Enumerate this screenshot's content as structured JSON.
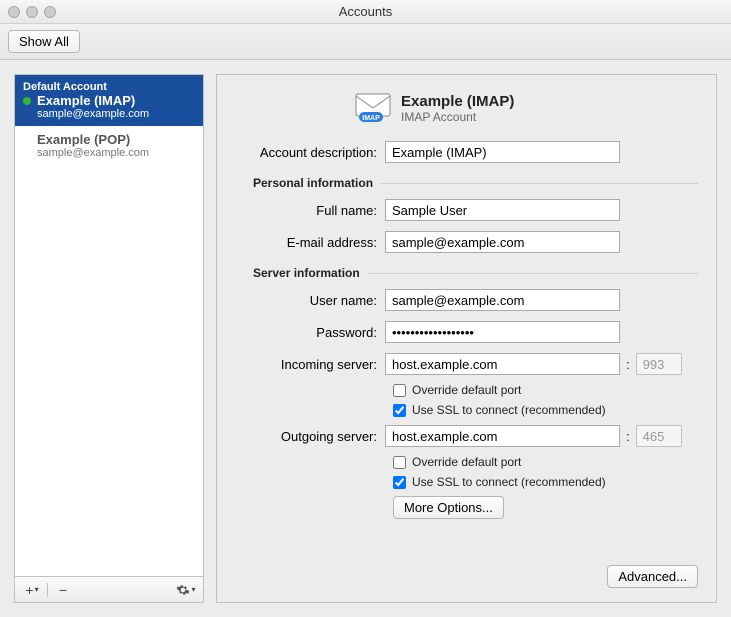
{
  "window": {
    "title": "Accounts"
  },
  "toolbar": {
    "show_all": "Show All"
  },
  "sidebar": {
    "default_label": "Default Account",
    "items": [
      {
        "name": "Example (IMAP)",
        "email": "sample@example.com",
        "selected": true,
        "status": "online"
      },
      {
        "name": "Example (POP)",
        "email": "sample@example.com",
        "selected": false
      }
    ]
  },
  "panel": {
    "title": "Example (IMAP)",
    "subtitle": "IMAP Account",
    "labels": {
      "account_description": "Account description:",
      "personal_info": "Personal information",
      "full_name": "Full name:",
      "email": "E-mail address:",
      "server_info": "Server information",
      "user_name": "User name:",
      "password": "Password:",
      "incoming": "Incoming server:",
      "outgoing": "Outgoing server:",
      "override_port": "Override default port",
      "use_ssl": "Use SSL to connect (recommended)",
      "more_options": "More Options...",
      "advanced": "Advanced...",
      "port_sep": ":"
    },
    "values": {
      "account_description": "Example (IMAP)",
      "full_name": "Sample User",
      "email": "sample@example.com",
      "user_name": "sample@example.com",
      "password": "••••••••••••••••••",
      "incoming_host": "host.example.com",
      "incoming_port": "993",
      "incoming_override": false,
      "incoming_ssl": true,
      "outgoing_host": "host.example.com",
      "outgoing_port": "465",
      "outgoing_override": false,
      "outgoing_ssl": true
    }
  }
}
